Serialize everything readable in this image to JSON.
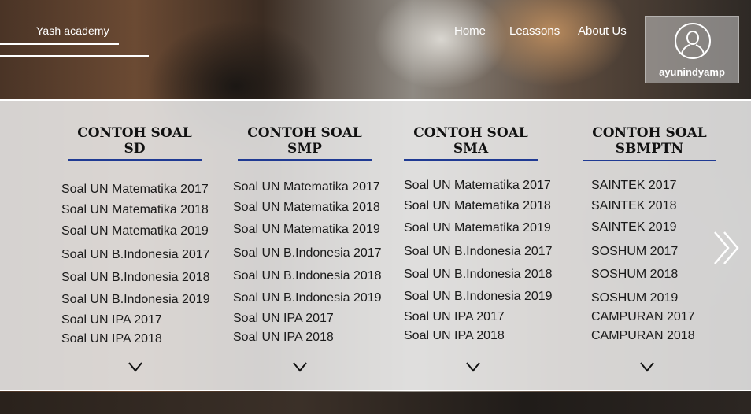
{
  "brand": "Yash academy",
  "nav": {
    "home": "Home",
    "lessons": "Leassons",
    "about": "About Us"
  },
  "user": {
    "name": "ayunindyamp",
    "icon": "user-outline-icon"
  },
  "accent": "#1f3a93",
  "columns": [
    {
      "title": "CONTOH SOAL\nSD",
      "items": [
        "Soal UN Matematika 2017",
        "Soal UN Matematika 2018",
        "Soal UN Matematika 2019",
        "Soal UN B.Indonesia 2017",
        "Soal UN B.Indonesia 2018",
        "Soal UN B.Indonesia 2019",
        "Soal UN IPA 2017",
        "Soal UN IPA 2018"
      ]
    },
    {
      "title": "CONTOH SOAL\nSMP",
      "items": [
        "Soal UN Matematika 2017",
        "Soal UN Matematika 2018",
        "Soal UN Matematika 2019",
        "Soal UN B.Indonesia 2017",
        "Soal UN B.Indonesia 2018",
        "Soal UN B.Indonesia 2019",
        "Soal UN IPA 2017",
        "Soal UN IPA 2018"
      ]
    },
    {
      "title": "CONTOH SOAL\nSMA",
      "items": [
        "Soal UN Matematika 2017",
        "Soal UN Matematika 2018",
        "Soal UN Matematika 2019",
        "Soal UN B.Indonesia 2017",
        "Soal UN B.Indonesia 2018",
        "Soal UN B.Indonesia 2019",
        "Soal UN IPA 2017",
        "Soal UN IPA 2018"
      ]
    },
    {
      "title": "CONTOH SOAL\nSBMPTN",
      "items": [
        "SAINTEK 2017",
        "SAINTEK 2018",
        "SAINTEK 2019",
        "SOSHUM 2017",
        "SOSHUM 2018",
        "SOSHUM 2019",
        "CAMPURAN 2017",
        "CAMPURAN 2018"
      ]
    }
  ],
  "icons": {
    "expand": "chevron-down-icon",
    "next": "double-chevron-right-icon"
  }
}
